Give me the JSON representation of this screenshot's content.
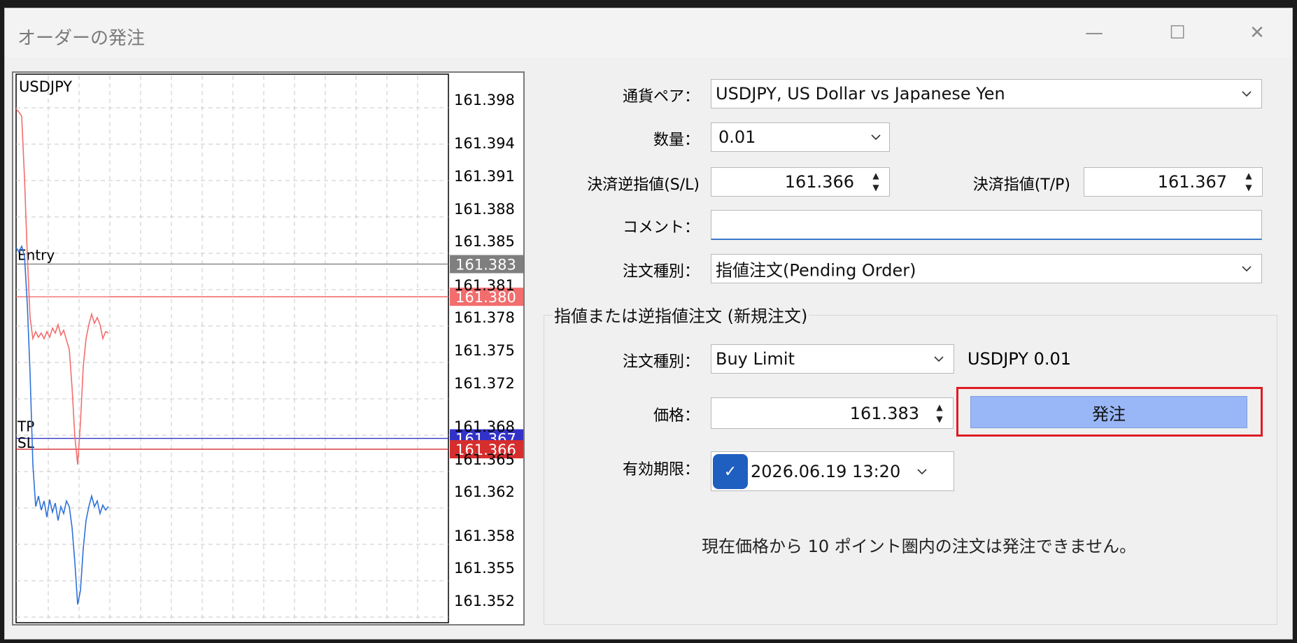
{
  "window": {
    "title": "オーダーの発注"
  },
  "chart": {
    "symbol": "USDJPY",
    "price_ticks": [
      "161.398",
      "161.394",
      "161.391",
      "161.388",
      "161.385",
      "161.381",
      "161.378",
      "161.375",
      "161.372",
      "161.368",
      "161.365",
      "161.362",
      "161.358",
      "161.355",
      "161.352"
    ],
    "line_labels": {
      "entry": "Entry",
      "tp": "TP",
      "sl": "SL"
    },
    "tags": {
      "entry": "161.383",
      "ask": "161.380",
      "tp": "161.367",
      "sl": "161.366"
    },
    "colors": {
      "ask": "#f26d6d",
      "bid": "#2f72d8",
      "entry_tag": "#7f7f7f",
      "ask_tag": "#f26d6d",
      "tp_tag": "#3232c8",
      "sl_tag": "#d62d2d"
    }
  },
  "form": {
    "symbol_label": "通貨ペア：",
    "symbol_value": "USDJPY, US Dollar vs Japanese Yen",
    "volume_label": "数量：",
    "volume_value": "0.01",
    "sl_label": "決済逆指値(S/L)",
    "sl_value": "161.366",
    "tp_label": "決済指値(T/P)",
    "tp_value": "161.367",
    "comment_label": "コメント：",
    "comment_value": "",
    "type_label": "注文種別：",
    "type_value": "指値注文(Pending Order)"
  },
  "pending": {
    "group_title": "指値または逆指値注文 (新規注文)",
    "type_label": "注文種別：",
    "type_value": "Buy Limit",
    "summary": "USDJPY 0.01",
    "price_label": "価格：",
    "price_value": "161.383",
    "order_button": "発注",
    "expiry_label": "有効期限：",
    "expiry_value": "2026.06.19 13:20",
    "expiry_checked": true,
    "note": "現在価格から 10 ポイント圏内の注文は発注できません。"
  }
}
